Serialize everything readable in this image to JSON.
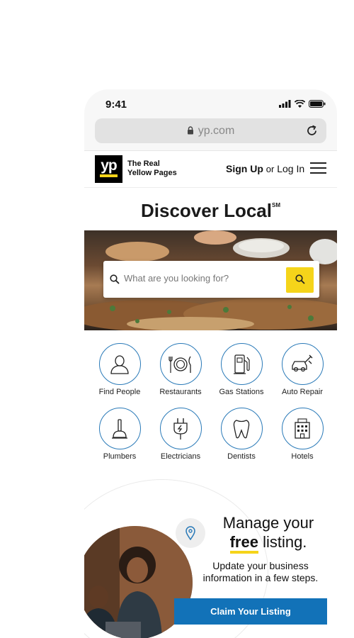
{
  "status_bar": {
    "time": "9:41"
  },
  "browser": {
    "url": "yp.com"
  },
  "header": {
    "logo_text": "yp",
    "brand_line1": "The Real",
    "brand_line2": "Yellow Pages",
    "sign_up": "Sign Up",
    "or_text": "or",
    "log_in": "Log In"
  },
  "hero": {
    "title": "Discover Local",
    "title_mark": "SM",
    "search_placeholder": "What are you looking for?"
  },
  "categories": [
    {
      "label": "Find People",
      "icon": "person-icon"
    },
    {
      "label": "Restaurants",
      "icon": "plate-icon"
    },
    {
      "label": "Gas Stations",
      "icon": "gas-pump-icon"
    },
    {
      "label": "Auto Repair",
      "icon": "car-wrench-icon"
    },
    {
      "label": "Plumbers",
      "icon": "plunger-icon"
    },
    {
      "label": "Electricians",
      "icon": "plug-icon"
    },
    {
      "label": "Dentists",
      "icon": "tooth-icon"
    },
    {
      "label": "Hotels",
      "icon": "hotel-icon"
    }
  ],
  "promo": {
    "title_line1": "Manage your",
    "title_free": "free",
    "title_rest": "listing.",
    "subtitle": "Update your business information in a few steps.",
    "claim_button": "Claim Your Listing"
  },
  "colors": {
    "accent_yellow": "#f5d41a",
    "accent_blue": "#1272b8",
    "icon_blue": "#2a7ab8"
  }
}
